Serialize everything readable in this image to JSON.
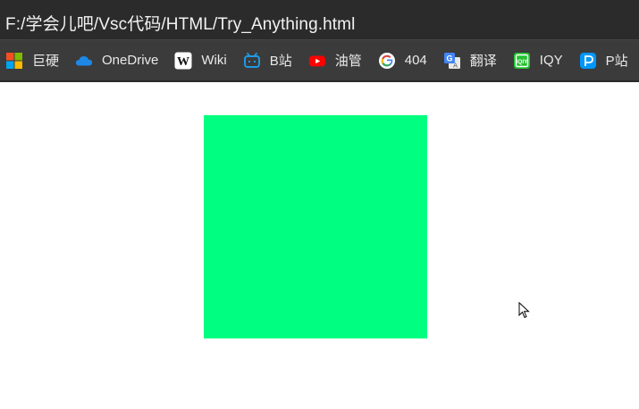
{
  "address_bar": {
    "url": "F:/学会儿吧/Vsc代码/HTML/Try_Anything.html"
  },
  "bookmarks": [
    {
      "label": "巨硬",
      "icon": "microsoft-icon"
    },
    {
      "label": "OneDrive",
      "icon": "onedrive-cloud-icon"
    },
    {
      "label": "Wiki",
      "icon": "wikipedia-icon"
    },
    {
      "label": "B站",
      "icon": "bilibili-icon"
    },
    {
      "label": "油管",
      "icon": "youtube-icon"
    },
    {
      "label": "404",
      "icon": "google-icon"
    },
    {
      "label": "翻译",
      "icon": "google-translate-icon"
    },
    {
      "label": "IQY",
      "icon": "iqiyi-icon"
    },
    {
      "label": "P站",
      "icon": "pixiv-icon"
    }
  ],
  "content": {
    "square_color": "#00ff80"
  },
  "colors": {
    "chrome_dark": "#2b2b2b",
    "bookmark_bar": "#3b3b3b",
    "page_background": "#ffffff"
  }
}
